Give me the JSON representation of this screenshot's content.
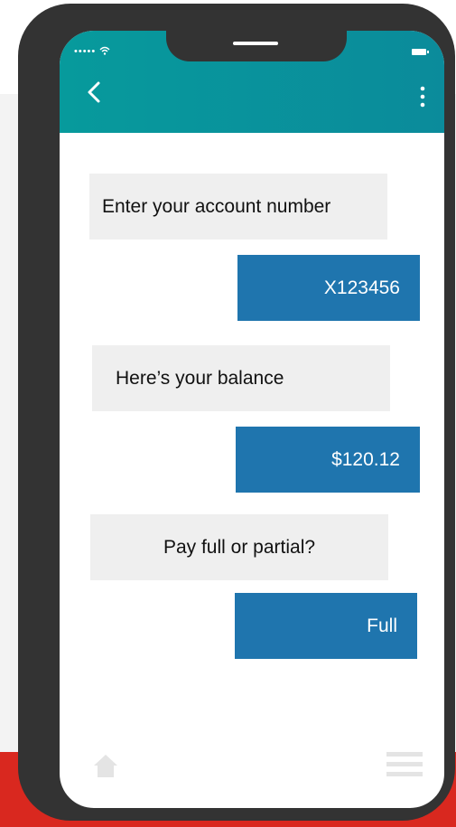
{
  "status_bar": {
    "signal": "•••••"
  },
  "conversation": [
    {
      "role": "bot",
      "text": "Enter your account number"
    },
    {
      "role": "user",
      "text": "X123456"
    },
    {
      "role": "bot",
      "text": "Here’s your balance"
    },
    {
      "role": "user",
      "text": "$120.12"
    },
    {
      "role": "bot",
      "text": "Pay full or partial?"
    },
    {
      "role": "user",
      "text": "Full"
    }
  ],
  "colors": {
    "app_bar": "#0a929c",
    "bot_bubble": "#efefef",
    "user_bubble": "#1f75ae",
    "phone_frame": "#333333",
    "accent_red": "#d9281f"
  },
  "icons": {
    "back": "chevron-left-icon",
    "menu": "more-vertical-icon",
    "home": "home-icon",
    "hamburger": "hamburger-menu-icon",
    "wifi": "wifi-icon",
    "battery": "battery-icon"
  }
}
